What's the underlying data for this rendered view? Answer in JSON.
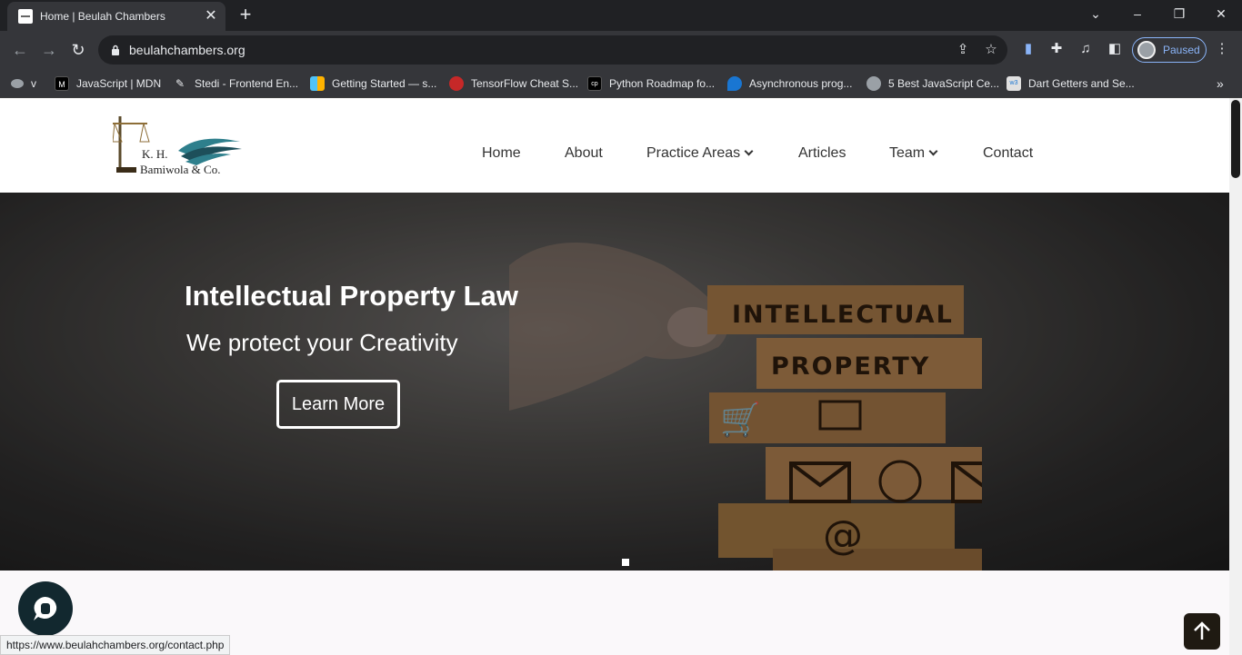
{
  "browser": {
    "tab_title": "Home | Beulah Chambers",
    "url": "beulahchambers.org",
    "profile_status": "Paused",
    "bookmarks": [
      {
        "label": "v"
      },
      {
        "label": "JavaScript | MDN"
      },
      {
        "label": "Stedi - Frontend En..."
      },
      {
        "label": "Getting Started — s..."
      },
      {
        "label": "TensorFlow Cheat S..."
      },
      {
        "label": "Python Roadmap fo..."
      },
      {
        "label": "Asynchronous prog..."
      },
      {
        "label": "5 Best JavaScript Ce..."
      },
      {
        "label": "Dart Getters and Se..."
      }
    ],
    "status_url": "https://www.beulahchambers.org/contact.php"
  },
  "site": {
    "logo": {
      "initials": "K. H.",
      "name": "Bamiwola & Co."
    },
    "nav": [
      "Home",
      "About",
      "Practice Areas",
      "Articles",
      "Team",
      "Contact"
    ],
    "hero": {
      "title": "Intellectual Property Law",
      "subtitle": "We protect your Creativity",
      "cta": "Learn More",
      "image_text": [
        "INTELLECTUAL",
        "PROPERTY"
      ]
    }
  },
  "colors": {
    "accent": "#2e7f8c",
    "chat_bubble": "#12282f",
    "scroll_top": "#1f1a12"
  }
}
